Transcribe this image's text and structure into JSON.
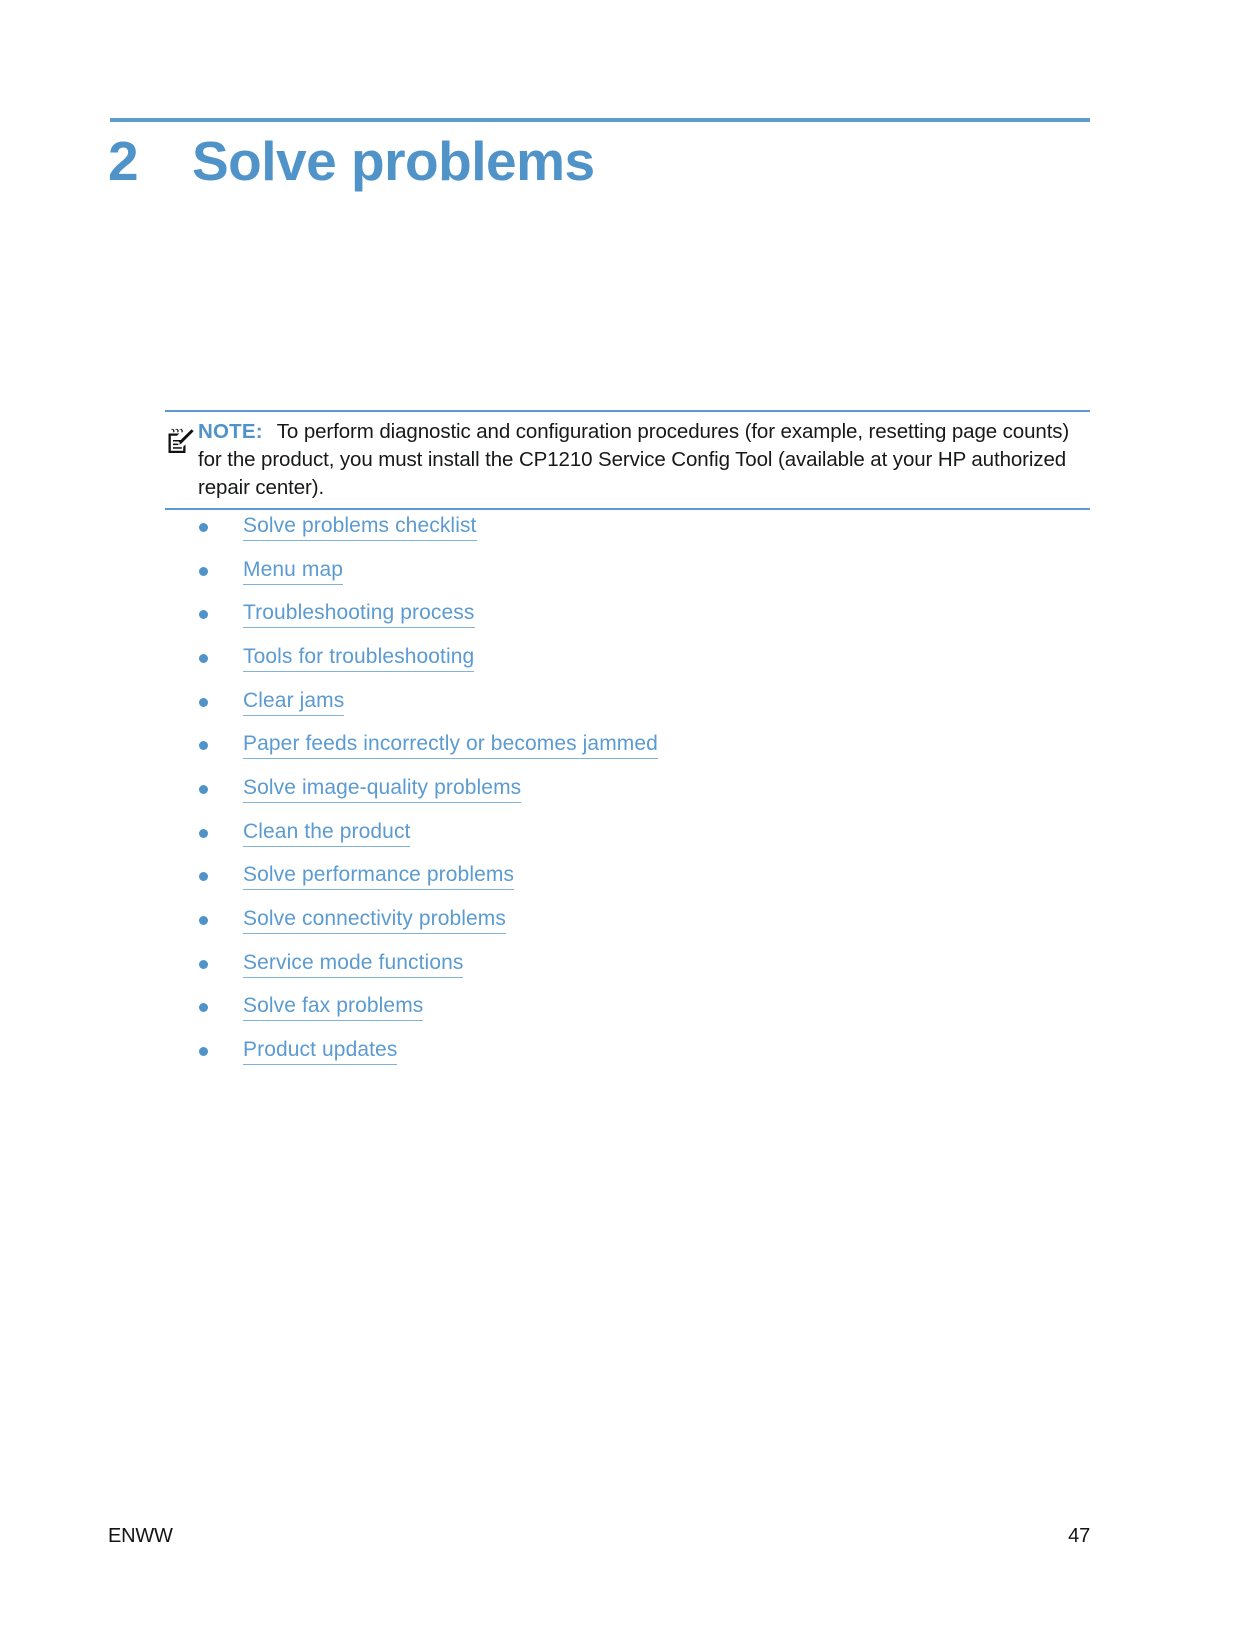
{
  "chapter": {
    "number": "2",
    "title": "Solve problems",
    "accent_color": "#4f93c9"
  },
  "note": {
    "icon": "note-pad-pencil-icon",
    "label": "NOTE:",
    "text": "To perform diagnostic and configuration procedures (for example, resetting page counts) for the product, you must install the CP1210 Service Config Tool (available at your HP authorized repair center).",
    "rule_color": "#5b9bd1"
  },
  "toc": {
    "links": [
      {
        "label": "Solve problems checklist"
      },
      {
        "label": "Menu map"
      },
      {
        "label": "Troubleshooting process"
      },
      {
        "label": "Tools for troubleshooting"
      },
      {
        "label": "Clear jams"
      },
      {
        "label": "Paper feeds incorrectly or becomes jammed"
      },
      {
        "label": "Solve image-quality problems"
      },
      {
        "label": "Clean the product"
      },
      {
        "label": "Solve performance problems"
      },
      {
        "label": "Solve connectivity problems"
      },
      {
        "label": "Service mode functions"
      },
      {
        "label": "Solve fax problems"
      },
      {
        "label": "Product updates"
      }
    ],
    "link_color": "#5b9bd1",
    "bullet_color": "#4f93c9"
  },
  "footer": {
    "left": "ENWW",
    "page_number": "47"
  }
}
